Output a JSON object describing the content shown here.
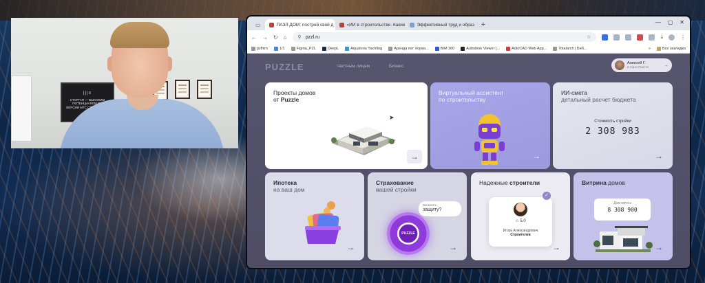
{
  "webcam": {
    "poster_logo": "|||≡",
    "poster_text": "СТАРТАП — ВЫСОКИМ ПОТЕНЦИАЛОМ ПО ВЕРСИИ МТС СТАРТАП ХАБ"
  },
  "browser": {
    "tabs": [
      {
        "label": "ПАЗЛ ДОМ: построй свой д",
        "active": true
      },
      {
        "label": "«ИИ в строительстве. Какие",
        "active": false
      },
      {
        "label": "Эффективный труд и образ",
        "active": false
      }
    ],
    "url": "pzzl.ru",
    "bookmarks": [
      "pzlhim",
      "1/1",
      "Figma_PZL",
      "DeepL",
      "Aquatoria Yachting",
      "Аренда яхт Хорва...",
      "BIM 360",
      "Autodesk Viewer |...",
      "AutoCAD Web App...",
      "Totalarch | Биб..."
    ],
    "all_bookmarks_label": "Все закладки"
  },
  "site": {
    "brand": "PUZZLE",
    "nav": [
      "Частным лицам",
      "Бизнес"
    ],
    "user": {
      "name": "Алексей Г.",
      "sub": "в горах Пьесте"
    }
  },
  "cards": {
    "projects": {
      "line1": "Проекты домов",
      "line2_prefix": "от ",
      "line2_bold": "Puzzle"
    },
    "assistant": {
      "line1": "Виртуальный ассистент",
      "line2": "по строительству"
    },
    "ai_estimate": {
      "line1": "ИИ-смета",
      "line2": "детальный расчет бюджета",
      "cost_label": "Стоимость стройки",
      "cost_value": "2 308 983"
    },
    "mortgage": {
      "line1": "Ипотека",
      "line2": "на ваш дом"
    },
    "insurance": {
      "line1": "Страхование",
      "line2": "вашей стройки",
      "bubble_small": "Включить",
      "bubble_big": "защиту?",
      "ring_text": "PUZZLE"
    },
    "builders": {
      "line1_prefix": "Надежные ",
      "line1_bold": "строители",
      "rating": "5.0",
      "name": "Игорь Александрович",
      "role": "Строителев"
    },
    "showcase": {
      "line1_bold": "Витрина",
      "line1_suffix": " домов",
      "price_label": "Дом мечты",
      "price_value": "8 308 900"
    }
  },
  "arrow_glyph": "→",
  "colors": {
    "page_bg": "#55526c",
    "assistant_card": "#a9a6e8",
    "insurance_ring": "#8f3bdc",
    "showcase_card": "#c4c2ea"
  }
}
